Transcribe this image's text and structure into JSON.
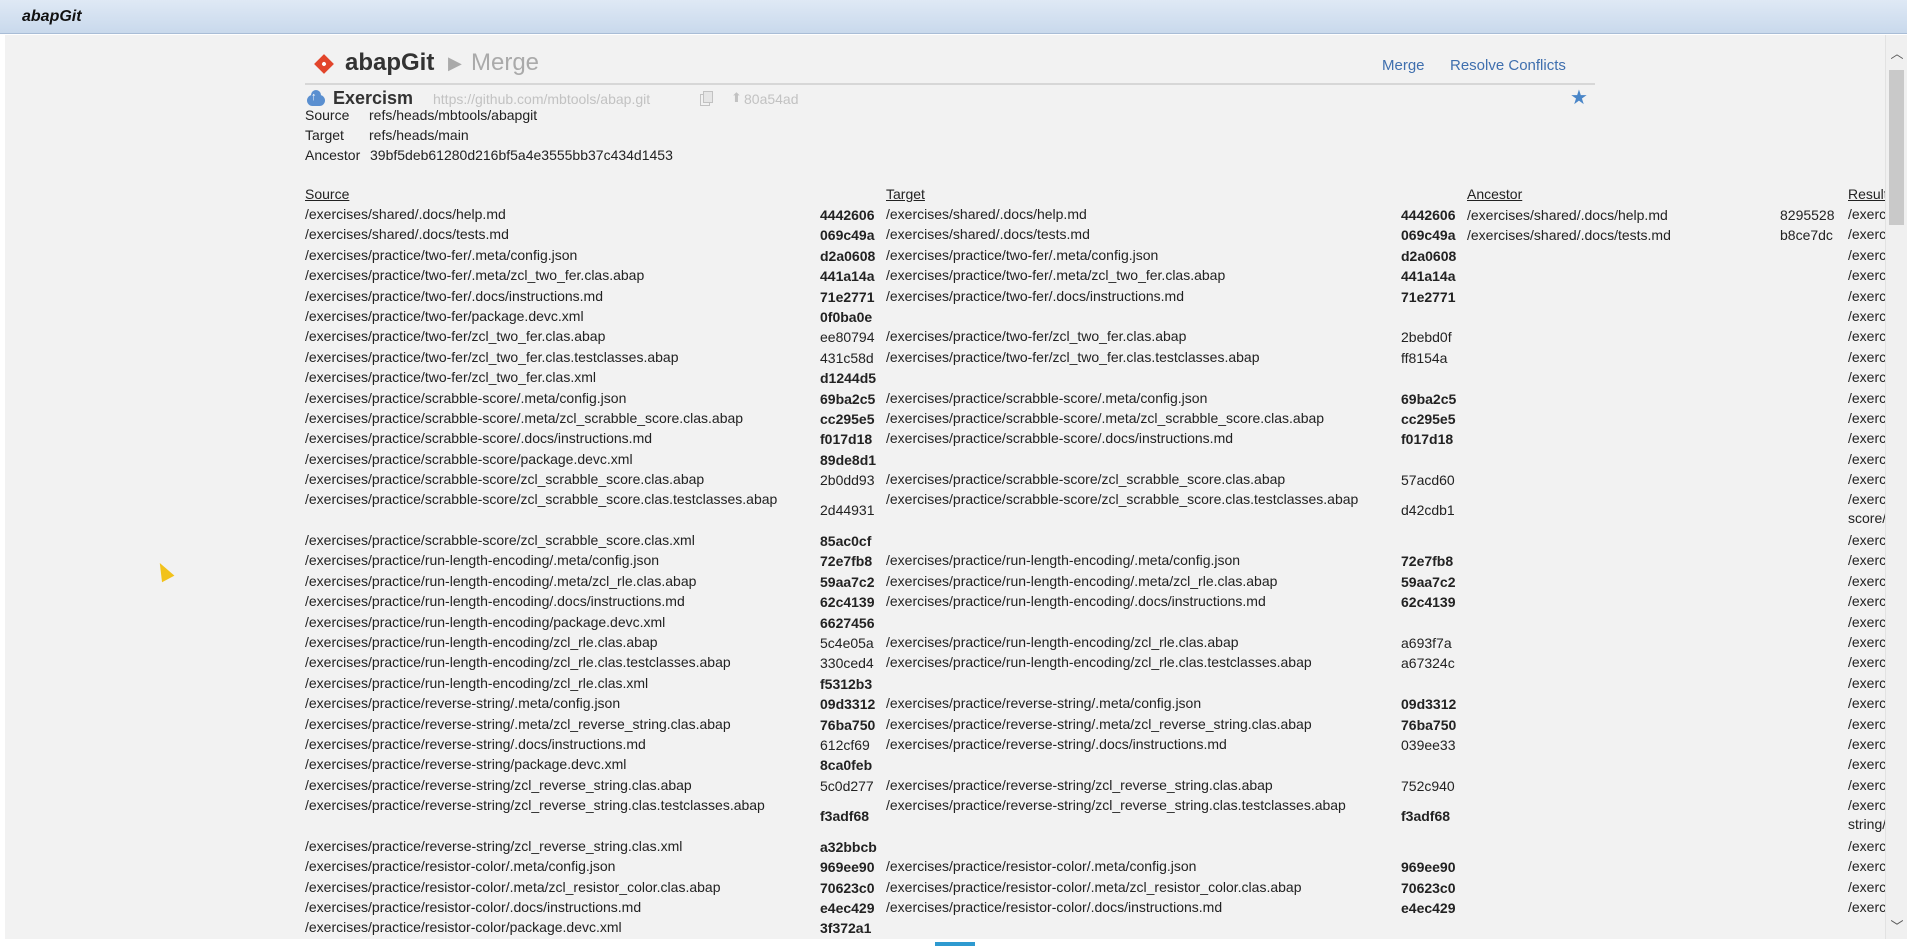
{
  "window": {
    "title": "abapGit"
  },
  "header": {
    "brand": "abapGit",
    "crumb_sep": "▶",
    "crumb": "Merge",
    "links": {
      "merge": "Merge",
      "resolve": "Resolve Conflicts"
    }
  },
  "repo": {
    "name": "Exercism",
    "url": "https://github.com/mbtools/abap.git",
    "commit_icon": "⬆",
    "commit": "80a54ad",
    "star": "★"
  },
  "info": {
    "source_label": "Source",
    "source_value": "refs/heads/mbtools/abapgit",
    "target_label": "Target",
    "target_value": "refs/heads/main",
    "ancestor_label": "Ancestor",
    "ancestor_value": "39bf5deb61280d216bf5a4e3555bb37c434d1453"
  },
  "columns": {
    "source": "Source",
    "target": "Target",
    "ancestor": "Ancestor",
    "result": "Result"
  },
  "rows": [
    {
      "src": "/exercises/shared/.docs/help.md",
      "sh": "4442606",
      "shb": true,
      "tgt": "/exercises/shared/.docs/help.md",
      "th": "4442606",
      "thb": true,
      "anc": "/exercises/shared/.docs/help.md",
      "ah": "8295528",
      "ahb": false,
      "res": "/exerc"
    },
    {
      "src": "/exercises/shared/.docs/tests.md",
      "sh": "069c49a",
      "shb": true,
      "tgt": "/exercises/shared/.docs/tests.md",
      "th": "069c49a",
      "thb": true,
      "anc": "/exercises/shared/.docs/tests.md",
      "ah": "b8ce7dc",
      "ahb": false,
      "res": "/exerc"
    },
    {
      "src": "/exercises/practice/two-fer/.meta/config.json",
      "sh": "d2a0608",
      "shb": true,
      "tgt": "/exercises/practice/two-fer/.meta/config.json",
      "th": "d2a0608",
      "thb": true,
      "anc": "",
      "ah": "",
      "ahb": false,
      "res": "/exerc"
    },
    {
      "src": "/exercises/practice/two-fer/.meta/zcl_two_fer.clas.abap",
      "sh": "441a14a",
      "shb": true,
      "tgt": "/exercises/practice/two-fer/.meta/zcl_two_fer.clas.abap",
      "th": "441a14a",
      "thb": true,
      "anc": "",
      "ah": "",
      "ahb": false,
      "res": "/exerc"
    },
    {
      "src": "/exercises/practice/two-fer/.docs/instructions.md",
      "sh": "71e2771",
      "shb": true,
      "tgt": "/exercises/practice/two-fer/.docs/instructions.md",
      "th": "71e2771",
      "thb": true,
      "anc": "",
      "ah": "",
      "ahb": false,
      "res": "/exerc"
    },
    {
      "src": "/exercises/practice/two-fer/package.devc.xml",
      "sh": "0f0ba0e",
      "shb": true,
      "tgt": "",
      "th": "",
      "thb": false,
      "anc": "",
      "ah": "",
      "ahb": false,
      "res": "/exerc"
    },
    {
      "src": "/exercises/practice/two-fer/zcl_two_fer.clas.abap",
      "sh": "ee80794",
      "shb": false,
      "tgt": "/exercises/practice/two-fer/zcl_two_fer.clas.abap",
      "th": "2bebd0f",
      "thb": false,
      "anc": "",
      "ah": "",
      "ahb": false,
      "res": "/exerc"
    },
    {
      "src": "/exercises/practice/two-fer/zcl_two_fer.clas.testclasses.abap",
      "sh": "431c58d",
      "shb": false,
      "tgt": "/exercises/practice/two-fer/zcl_two_fer.clas.testclasses.abap",
      "th": "ff8154a",
      "thb": false,
      "anc": "",
      "ah": "",
      "ahb": false,
      "res": "/exerc"
    },
    {
      "src": "/exercises/practice/two-fer/zcl_two_fer.clas.xml",
      "sh": "d1244d5",
      "shb": true,
      "tgt": "",
      "th": "",
      "thb": false,
      "anc": "",
      "ah": "",
      "ahb": false,
      "res": "/exerc"
    },
    {
      "src": "/exercises/practice/scrabble-score/.meta/config.json",
      "sh": "69ba2c5",
      "shb": true,
      "tgt": "/exercises/practice/scrabble-score/.meta/config.json",
      "th": "69ba2c5",
      "thb": true,
      "anc": "",
      "ah": "",
      "ahb": false,
      "res": "/exerc"
    },
    {
      "src": "/exercises/practice/scrabble-score/.meta/zcl_scrabble_score.clas.abap",
      "sh": "cc295e5",
      "shb": true,
      "tgt": "/exercises/practice/scrabble-score/.meta/zcl_scrabble_score.clas.abap",
      "th": "cc295e5",
      "thb": true,
      "anc": "",
      "ah": "",
      "ahb": false,
      "res": "/exerc"
    },
    {
      "src": "/exercises/practice/scrabble-score/.docs/instructions.md",
      "sh": "f017d18",
      "shb": true,
      "tgt": "/exercises/practice/scrabble-score/.docs/instructions.md",
      "th": "f017d18",
      "thb": true,
      "anc": "",
      "ah": "",
      "ahb": false,
      "res": "/exerc"
    },
    {
      "src": "/exercises/practice/scrabble-score/package.devc.xml",
      "sh": "89de8d1",
      "shb": true,
      "tgt": "",
      "th": "",
      "thb": false,
      "anc": "",
      "ah": "",
      "ahb": false,
      "res": "/exerc"
    },
    {
      "src": "/exercises/practice/scrabble-score/zcl_scrabble_score.clas.abap",
      "sh": "2b0dd93",
      "shb": false,
      "tgt": "/exercises/practice/scrabble-score/zcl_scrabble_score.clas.abap",
      "th": "57acd60",
      "thb": false,
      "anc": "",
      "ah": "",
      "ahb": false,
      "res": "/exerc"
    },
    {
      "src": "/exercises/practice/scrabble-score/zcl_scrabble_score.clas.testclasses.abap",
      "sh": "2d44931",
      "shb": false,
      "tgt": "/exercises/practice/scrabble-score/zcl_scrabble_score.clas.testclasses.abap",
      "th": "d42cdb1",
      "thb": false,
      "anc": "",
      "ah": "",
      "ahb": false,
      "res": "/exercises/practice/scrabble-score/zcl_scrabble_score.clas.testclasses.abap",
      "tall": true
    },
    {
      "src": "/exercises/practice/scrabble-score/zcl_scrabble_score.clas.xml",
      "sh": "85ac0cf",
      "shb": true,
      "tgt": "",
      "th": "",
      "thb": false,
      "anc": "",
      "ah": "",
      "ahb": false,
      "res": "/exerc"
    },
    {
      "src": "/exercises/practice/run-length-encoding/.meta/config.json",
      "sh": "72e7fb8",
      "shb": true,
      "tgt": "/exercises/practice/run-length-encoding/.meta/config.json",
      "th": "72e7fb8",
      "thb": true,
      "anc": "",
      "ah": "",
      "ahb": false,
      "res": "/exerc"
    },
    {
      "src": "/exercises/practice/run-length-encoding/.meta/zcl_rle.clas.abap",
      "sh": "59aa7c2",
      "shb": true,
      "tgt": "/exercises/practice/run-length-encoding/.meta/zcl_rle.clas.abap",
      "th": "59aa7c2",
      "thb": true,
      "anc": "",
      "ah": "",
      "ahb": false,
      "res": "/exerc"
    },
    {
      "src": "/exercises/practice/run-length-encoding/.docs/instructions.md",
      "sh": "62c4139",
      "shb": true,
      "tgt": "/exercises/practice/run-length-encoding/.docs/instructions.md",
      "th": "62c4139",
      "thb": true,
      "anc": "",
      "ah": "",
      "ahb": false,
      "res": "/exerc"
    },
    {
      "src": "/exercises/practice/run-length-encoding/package.devc.xml",
      "sh": "6627456",
      "shb": true,
      "tgt": "",
      "th": "",
      "thb": false,
      "anc": "",
      "ah": "",
      "ahb": false,
      "res": "/exerc"
    },
    {
      "src": "/exercises/practice/run-length-encoding/zcl_rle.clas.abap",
      "sh": "5c4e05a",
      "shb": false,
      "tgt": "/exercises/practice/run-length-encoding/zcl_rle.clas.abap",
      "th": "a693f7a",
      "thb": false,
      "anc": "",
      "ah": "",
      "ahb": false,
      "res": "/exerc"
    },
    {
      "src": "/exercises/practice/run-length-encoding/zcl_rle.clas.testclasses.abap",
      "sh": "330ced4",
      "shb": false,
      "tgt": "/exercises/practice/run-length-encoding/zcl_rle.clas.testclasses.abap",
      "th": "a67324c",
      "thb": false,
      "anc": "",
      "ah": "",
      "ahb": false,
      "res": "/exerc"
    },
    {
      "src": "/exercises/practice/run-length-encoding/zcl_rle.clas.xml",
      "sh": "f5312b3",
      "shb": true,
      "tgt": "",
      "th": "",
      "thb": false,
      "anc": "",
      "ah": "",
      "ahb": false,
      "res": "/exerc"
    },
    {
      "src": "/exercises/practice/reverse-string/.meta/config.json",
      "sh": "09d3312",
      "shb": true,
      "tgt": "/exercises/practice/reverse-string/.meta/config.json",
      "th": "09d3312",
      "thb": true,
      "anc": "",
      "ah": "",
      "ahb": false,
      "res": "/exerc"
    },
    {
      "src": "/exercises/practice/reverse-string/.meta/zcl_reverse_string.clas.abap",
      "sh": "76ba750",
      "shb": true,
      "tgt": "/exercises/practice/reverse-string/.meta/zcl_reverse_string.clas.abap",
      "th": "76ba750",
      "thb": true,
      "anc": "",
      "ah": "",
      "ahb": false,
      "res": "/exerc"
    },
    {
      "src": "/exercises/practice/reverse-string/.docs/instructions.md",
      "sh": "612cf69",
      "shb": false,
      "tgt": "/exercises/practice/reverse-string/.docs/instructions.md",
      "th": "039ee33",
      "thb": false,
      "anc": "",
      "ah": "",
      "ahb": false,
      "res": "/exerc"
    },
    {
      "src": "/exercises/practice/reverse-string/package.devc.xml",
      "sh": "8ca0feb",
      "shb": true,
      "tgt": "",
      "th": "",
      "thb": false,
      "anc": "",
      "ah": "",
      "ahb": false,
      "res": "/exerc"
    },
    {
      "src": "/exercises/practice/reverse-string/zcl_reverse_string.clas.abap",
      "sh": "5c0d277",
      "shb": false,
      "tgt": "/exercises/practice/reverse-string/zcl_reverse_string.clas.abap",
      "th": "752c940",
      "thb": false,
      "anc": "",
      "ah": "",
      "ahb": false,
      "res": "/exerc"
    },
    {
      "src": "/exercises/practice/reverse-string/zcl_reverse_string.clas.testclasses.abap",
      "sh": "f3adf68",
      "shb": true,
      "tgt": "/exercises/practice/reverse-string/zcl_reverse_string.clas.testclasses.abap",
      "th": "f3adf68",
      "thb": true,
      "anc": "",
      "ah": "",
      "ahb": false,
      "res": "/exercises/practice/reverse-string/zcl_reverse_string.clas.testclasses.abap",
      "tall": true
    },
    {
      "src": "/exercises/practice/reverse-string/zcl_reverse_string.clas.xml",
      "sh": "a32bbcb",
      "shb": true,
      "tgt": "",
      "th": "",
      "thb": false,
      "anc": "",
      "ah": "",
      "ahb": false,
      "res": "/exerc"
    },
    {
      "src": "/exercises/practice/resistor-color/.meta/config.json",
      "sh": "969ee90",
      "shb": true,
      "tgt": "/exercises/practice/resistor-color/.meta/config.json",
      "th": "969ee90",
      "thb": true,
      "anc": "",
      "ah": "",
      "ahb": false,
      "res": "/exerc"
    },
    {
      "src": "/exercises/practice/resistor-color/.meta/zcl_resistor_color.clas.abap",
      "sh": "70623c0",
      "shb": true,
      "tgt": "/exercises/practice/resistor-color/.meta/zcl_resistor_color.clas.abap",
      "th": "70623c0",
      "thb": true,
      "anc": "",
      "ah": "",
      "ahb": false,
      "res": "/exerc"
    },
    {
      "src": "/exercises/practice/resistor-color/.docs/instructions.md",
      "sh": "e4ec429",
      "shb": true,
      "tgt": "/exercises/practice/resistor-color/.docs/instructions.md",
      "th": "e4ec429",
      "thb": true,
      "anc": "",
      "ah": "",
      "ahb": false,
      "res": "/exerc"
    },
    {
      "src": "/exercises/practice/resistor-color/package.devc.xml",
      "sh": "3f372a1",
      "shb": true,
      "tgt": "",
      "th": "",
      "thb": false,
      "anc": "",
      "ah": "",
      "ahb": false,
      "res": ""
    }
  ]
}
